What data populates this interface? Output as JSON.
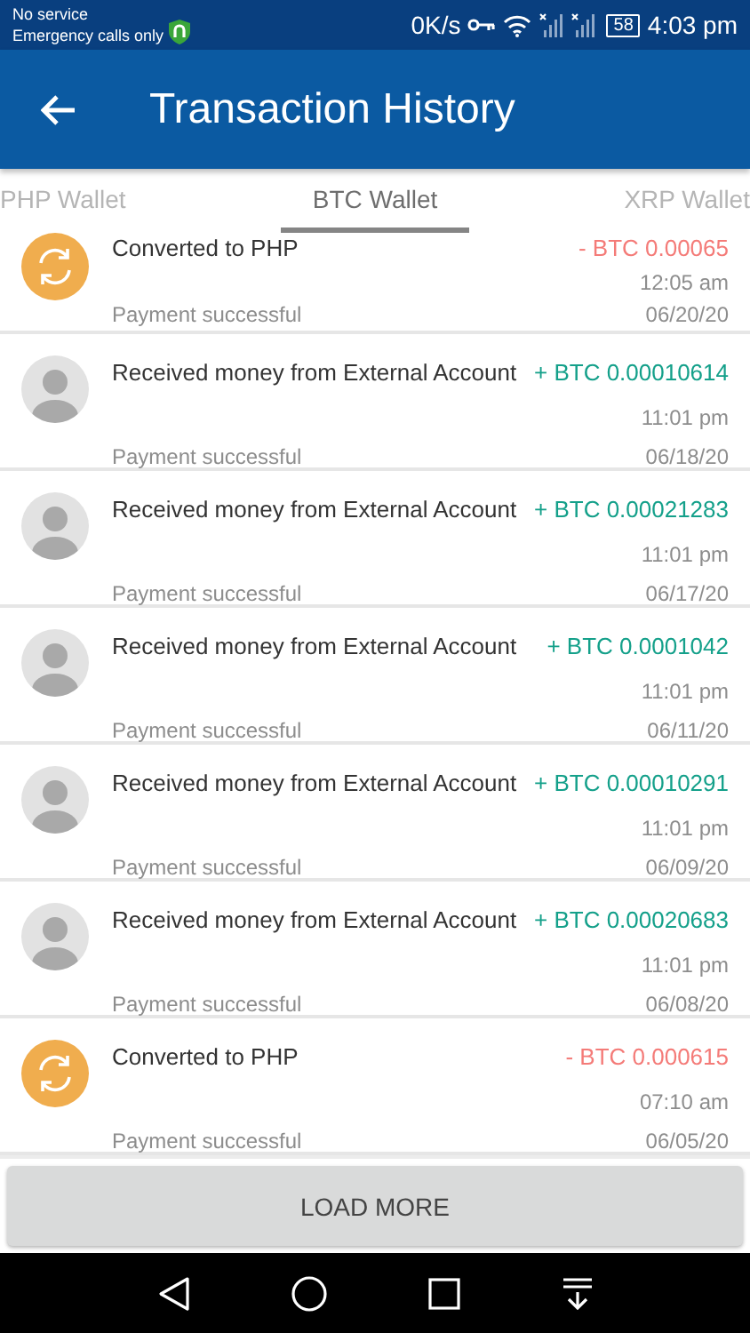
{
  "status_bar": {
    "carrier": "No service",
    "carrier_note": "Emergency calls only",
    "speed": "0K/s",
    "battery": "58",
    "time": "4:03 pm"
  },
  "app_bar": {
    "title": "Transaction History"
  },
  "tabs": [
    {
      "label": "PHP Wallet",
      "selected": false
    },
    {
      "label": "BTC Wallet",
      "selected": true
    },
    {
      "label": "XRP Wallet",
      "selected": false
    }
  ],
  "transactions": [
    {
      "kind": "conversion",
      "title": "Converted to PHP",
      "amount": "- BTC 0.00065",
      "time": "12:05 am",
      "status": "Payment successful",
      "date": "06/20/20"
    },
    {
      "kind": "received",
      "title": "Received money from External Account",
      "amount": "+ BTC 0.00010614",
      "time": "11:01 pm",
      "status": "Payment successful",
      "date": "06/18/20"
    },
    {
      "kind": "received",
      "title": "Received money from External Account",
      "amount": "+ BTC 0.00021283",
      "time": "11:01 pm",
      "status": "Payment successful",
      "date": "06/17/20"
    },
    {
      "kind": "received",
      "title": "Received money from External Account",
      "amount": "+ BTC 0.0001042",
      "time": "11:01 pm",
      "status": "Payment successful",
      "date": "06/11/20"
    },
    {
      "kind": "received",
      "title": "Received money from External Account",
      "amount": "+ BTC 0.00010291",
      "time": "11:01 pm",
      "status": "Payment successful",
      "date": "06/09/20"
    },
    {
      "kind": "received",
      "title": "Received money from External Account",
      "amount": "+ BTC 0.00020683",
      "time": "11:01 pm",
      "status": "Payment successful",
      "date": "06/08/20"
    },
    {
      "kind": "conversion",
      "title": "Converted to PHP",
      "amount": "- BTC 0.000615",
      "time": "07:10 am",
      "status": "Payment successful",
      "date": "06/05/20"
    }
  ],
  "load_more": {
    "label": "LOAD MORE"
  }
}
